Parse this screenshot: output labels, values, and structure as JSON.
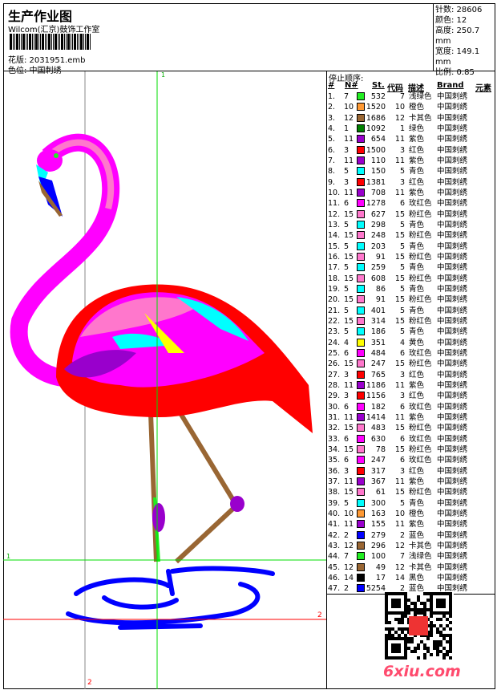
{
  "header": {
    "title": "生产作业图",
    "studio": "Wilcom(汇京)鼓饰工作室",
    "design": "花版: 2031951.emb",
    "colorway": "色位: 中国刺绣"
  },
  "stats": {
    "stitches": "针数: 28606",
    "colors": "颜色: 12",
    "height": "高度: 250.7 mm",
    "width": "宽度: 149.1 mm",
    "scale": "比例: 0.85"
  },
  "guides": {
    "v1": "1",
    "h1": "1",
    "h2": "2",
    "v2": "2"
  },
  "table": {
    "stop_label": "停止顺序:",
    "headers": [
      "#",
      "N#",
      "St.",
      "代码",
      "描述",
      "Brand",
      "元素"
    ],
    "rows": [
      [
        "1.",
        "7",
        "532",
        "7",
        "浅绿色",
        "中国刺绣",
        "#22ee22"
      ],
      [
        "2.",
        "10",
        "1520",
        "10",
        "橙色",
        "中国刺绣",
        "#ff9933"
      ],
      [
        "3.",
        "12",
        "1686",
        "12",
        "卡其色",
        "中国刺绣",
        "#996633"
      ],
      [
        "4.",
        "1",
        "1092",
        "1",
        "绿色",
        "中国刺绣",
        "#008000"
      ],
      [
        "5.",
        "11",
        "654",
        "11",
        "紫色",
        "中国刺绣",
        "#9900cc"
      ],
      [
        "6.",
        "3",
        "1500",
        "3",
        "红色",
        "中国刺绣",
        "#ff0000"
      ],
      [
        "7.",
        "11",
        "110",
        "11",
        "紫色",
        "中国刺绣",
        "#9900cc"
      ],
      [
        "8.",
        "5",
        "150",
        "5",
        "青色",
        "中国刺绣",
        "#00ffff"
      ],
      [
        "9.",
        "3",
        "1381",
        "3",
        "红色",
        "中国刺绣",
        "#ff0000"
      ],
      [
        "10.",
        "11",
        "708",
        "11",
        "紫色",
        "中国刺绣",
        "#9900cc"
      ],
      [
        "11.",
        "6",
        "1278",
        "6",
        "玫红色",
        "中国刺绣",
        "#ff00ff"
      ],
      [
        "12.",
        "15",
        "627",
        "15",
        "粉红色",
        "中国刺绣",
        "#ff77cc"
      ],
      [
        "13.",
        "5",
        "298",
        "5",
        "青色",
        "中国刺绣",
        "#00ffff"
      ],
      [
        "14.",
        "15",
        "248",
        "15",
        "粉红色",
        "中国刺绣",
        "#ff77cc"
      ],
      [
        "15.",
        "5",
        "203",
        "5",
        "青色",
        "中国刺绣",
        "#00ffff"
      ],
      [
        "16.",
        "15",
        "91",
        "15",
        "粉红色",
        "中国刺绣",
        "#ff77cc"
      ],
      [
        "17.",
        "5",
        "259",
        "5",
        "青色",
        "中国刺绣",
        "#00ffff"
      ],
      [
        "18.",
        "15",
        "608",
        "15",
        "粉红色",
        "中国刺绣",
        "#ff77cc"
      ],
      [
        "19.",
        "5",
        "86",
        "5",
        "青色",
        "中国刺绣",
        "#00ffff"
      ],
      [
        "20.",
        "15",
        "91",
        "15",
        "粉红色",
        "中国刺绣",
        "#ff77cc"
      ],
      [
        "21.",
        "5",
        "401",
        "5",
        "青色",
        "中国刺绣",
        "#00ffff"
      ],
      [
        "22.",
        "15",
        "314",
        "15",
        "粉红色",
        "中国刺绣",
        "#ff77cc"
      ],
      [
        "23.",
        "5",
        "186",
        "5",
        "青色",
        "中国刺绣",
        "#00ffff"
      ],
      [
        "24.",
        "4",
        "351",
        "4",
        "黄色",
        "中国刺绣",
        "#ffff00"
      ],
      [
        "25.",
        "6",
        "484",
        "6",
        "玫红色",
        "中国刺绣",
        "#ff00ff"
      ],
      [
        "26.",
        "15",
        "247",
        "15",
        "粉红色",
        "中国刺绣",
        "#ff77cc"
      ],
      [
        "27.",
        "3",
        "765",
        "3",
        "红色",
        "中国刺绣",
        "#ff0000"
      ],
      [
        "28.",
        "11",
        "1186",
        "11",
        "紫色",
        "中国刺绣",
        "#9900cc"
      ],
      [
        "29.",
        "3",
        "1156",
        "3",
        "红色",
        "中国刺绣",
        "#ff0000"
      ],
      [
        "30.",
        "6",
        "182",
        "6",
        "玫红色",
        "中国刺绣",
        "#ff00ff"
      ],
      [
        "31.",
        "11",
        "1414",
        "11",
        "紫色",
        "中国刺绣",
        "#9900cc"
      ],
      [
        "32.",
        "15",
        "483",
        "15",
        "粉红色",
        "中国刺绣",
        "#ff77cc"
      ],
      [
        "33.",
        "6",
        "630",
        "6",
        "玫红色",
        "中国刺绣",
        "#ff00ff"
      ],
      [
        "34.",
        "15",
        "78",
        "15",
        "粉红色",
        "中国刺绣",
        "#ff77cc"
      ],
      [
        "35.",
        "6",
        "247",
        "6",
        "玫红色",
        "中国刺绣",
        "#ff00ff"
      ],
      [
        "36.",
        "3",
        "317",
        "3",
        "红色",
        "中国刺绣",
        "#ff0000"
      ],
      [
        "37.",
        "11",
        "367",
        "11",
        "紫色",
        "中国刺绣",
        "#9900cc"
      ],
      [
        "38.",
        "15",
        "61",
        "15",
        "粉红色",
        "中国刺绣",
        "#ff77cc"
      ],
      [
        "39.",
        "5",
        "300",
        "5",
        "青色",
        "中国刺绣",
        "#00ffff"
      ],
      [
        "40.",
        "10",
        "163",
        "10",
        "橙色",
        "中国刺绣",
        "#ff9933"
      ],
      [
        "41.",
        "11",
        "155",
        "11",
        "紫色",
        "中国刺绣",
        "#9900cc"
      ],
      [
        "42.",
        "2",
        "279",
        "2",
        "蓝色",
        "中国刺绣",
        "#0000ff"
      ],
      [
        "43.",
        "12",
        "296",
        "12",
        "卡其色",
        "中国刺绣",
        "#996633"
      ],
      [
        "44.",
        "7",
        "100",
        "7",
        "浅绿色",
        "中国刺绣",
        "#22ee22"
      ],
      [
        "45.",
        "12",
        "49",
        "12",
        "卡其色",
        "中国刺绣",
        "#996633"
      ],
      [
        "46.",
        "14",
        "17",
        "14",
        "黑色",
        "中国刺绣",
        "#000000"
      ],
      [
        "47.",
        "2",
        "5254",
        "2",
        "蓝色",
        "中国刺绣",
        "#0000ff"
      ]
    ]
  },
  "watermark": "6xiu.com"
}
